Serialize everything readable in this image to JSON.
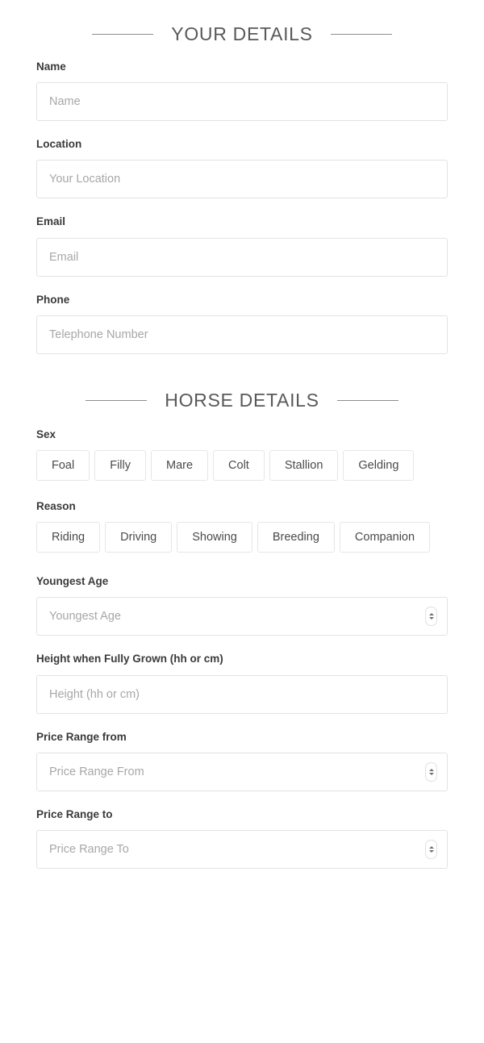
{
  "sections": [
    {
      "id": "your-details",
      "title": "YOUR DETAILS"
    },
    {
      "id": "horse-details",
      "title": "HORSE DETAILS"
    }
  ],
  "your_details": {
    "name": {
      "label": "Name",
      "placeholder": "Name",
      "value": ""
    },
    "location": {
      "label": "Location",
      "placeholder": "Your Location",
      "value": ""
    },
    "email": {
      "label": "Email",
      "placeholder": "Email",
      "value": ""
    },
    "phone": {
      "label": "Phone",
      "placeholder": "Telephone Number",
      "value": ""
    }
  },
  "horse_details": {
    "sex": {
      "label": "Sex",
      "options": [
        {
          "label": "Foal"
        },
        {
          "label": "Filly"
        },
        {
          "label": "Mare"
        },
        {
          "label": "Colt"
        },
        {
          "label": "Stallion"
        },
        {
          "label": "Gelding"
        }
      ]
    },
    "reason": {
      "label": "Reason",
      "options": [
        {
          "label": "Riding"
        },
        {
          "label": "Driving"
        },
        {
          "label": "Showing"
        },
        {
          "label": "Breeding"
        },
        {
          "label": "Companion"
        }
      ]
    },
    "youngest_age": {
      "label": "Youngest Age",
      "placeholder": "Youngest Age",
      "value": ""
    },
    "height": {
      "label": "Height when Fully Grown (hh or cm)",
      "placeholder": "Height (hh or cm)",
      "value": ""
    },
    "price_from": {
      "label": "Price Range from",
      "placeholder": "Price Range From",
      "value": ""
    },
    "price_to": {
      "label": "Price Range to",
      "placeholder": "Price Range To",
      "value": ""
    }
  },
  "icons": {
    "spinner_up": "chevron-up-icon",
    "spinner_down": "chevron-down-icon"
  },
  "colors": {
    "page_background": "#ffffff",
    "label_text": "#3a3a3a",
    "heading_text": "#595959",
    "heading_rule": "#8d8d8d",
    "input_border": "#e3e3e3",
    "placeholder_text": "#a7a7a7",
    "chip_border": "#e6e6e6",
    "chip_text": "#4a4a4a"
  }
}
